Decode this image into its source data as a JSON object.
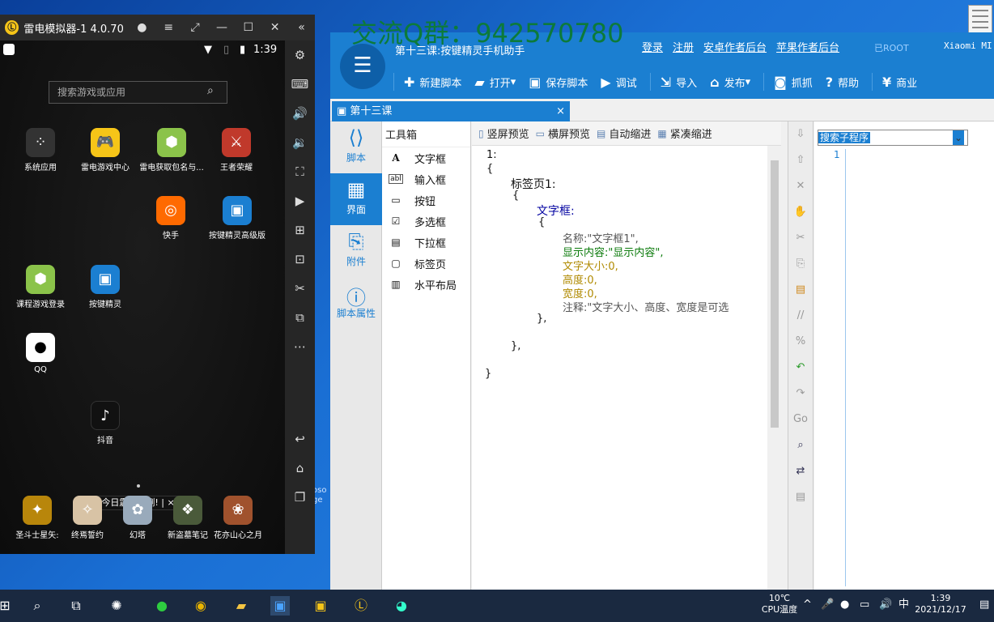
{
  "overlay": {
    "qq_group": "交流Q群：942570780"
  },
  "emulator": {
    "title": "雷电模拟器-1 4.0.70",
    "status_time": "1:39",
    "search_placeholder": "搜索游戏或应用",
    "apps": [
      "系统应用",
      "雷电游戏中心",
      "雷电获取包名与...",
      "王者荣耀",
      "快手",
      "按键精灵高级版",
      "课程游戏登录",
      "按键精灵",
      "QQ",
      "抖音"
    ],
    "toast": "今日震撼公测!",
    "toast_close": "×",
    "dock": [
      "圣斗士星矢:",
      "终焉誓约",
      "幻塔",
      "新盗墓笔记",
      "花亦山心之月"
    ],
    "side_icons": [
      "settings-icon",
      "keyboard-icon",
      "volume-up-icon",
      "volume-down-icon",
      "fullscreen-icon",
      "record-icon",
      "add-icon",
      "apk-icon",
      "scissors-icon",
      "video-icon",
      "more-icon",
      "back-icon",
      "home-icon",
      "recent-icon"
    ]
  },
  "ide": {
    "window_title": "第十三课:按键精灵手机助手",
    "links": [
      "登录",
      "注册",
      "安卓作者后台",
      "苹果作者后台"
    ],
    "root_label": "已ROOT",
    "device_label": "Xiaomi  MI",
    "toolbar": [
      "新建脚本",
      "打开",
      "保存脚本",
      "调试",
      "导入",
      "发布",
      "抓抓",
      "帮助",
      "商业"
    ],
    "tab": {
      "label": "第十三课",
      "close": "×"
    },
    "nav": [
      "脚本",
      "界面",
      "附件",
      "脚本属性"
    ],
    "toolbox_title": "工具箱",
    "toolbox": [
      "文字框",
      "输入框",
      "按钮",
      "多选框",
      "下拉框",
      "标签页",
      "水平布局"
    ],
    "editor_toolbar": [
      "竖屏预览",
      "横屏预览",
      "自动缩进",
      "紧凑缩进"
    ],
    "code": [
      "1:",
      "{",
      "标签页1:",
      "{",
      "文字框:",
      "{",
      "名称:\"文字框1\",",
      "显示内容:\"显示内容\",",
      "文字大小:0,",
      "高度:0,",
      "宽度:0,",
      "注释:\"文字大小、高度、宽度是可选",
      "},",
      "},",
      "}"
    ],
    "subroutine_search": "搜索子程序",
    "right_line": "1"
  },
  "taskbar": {
    "temp": "10℃",
    "temp_label": "CPU温度",
    "ime": "中",
    "time": "1:39",
    "date": "2021/12/17"
  },
  "desktop": {
    "edge_text": "oso ge"
  }
}
